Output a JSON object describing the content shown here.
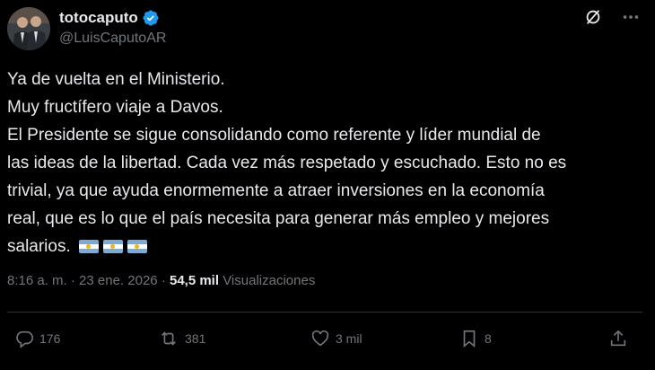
{
  "author": {
    "display_name": "totocaputo",
    "handle": "@LuisCaputoAR",
    "verified": true,
    "verified_color": "#1d9bf0"
  },
  "post": {
    "lines": [
      "Ya de vuelta en el Ministerio.",
      "Muy fructífero viaje a Davos.",
      "El Presidente se sigue consolidando como referente y líder mundial de",
      "las ideas de la libertad. Cada vez más respetado y escuchado. Esto no es",
      "trivial, ya que ayuda enormemente a atraer inversiones en la economía",
      "real, que es lo que el país necesita para generar más empleo y mejores",
      "salarios."
    ],
    "emoji": [
      "flag-argentina",
      "flag-argentina",
      "flag-argentina"
    ]
  },
  "meta": {
    "time": "8:16 a. m.",
    "separator": "·",
    "date": "23 ene. 2026",
    "views_count": "54,5 mil",
    "views_label": "Visualizaciones"
  },
  "actions": {
    "replies": "176",
    "reposts": "381",
    "likes": "3 mil",
    "bookmarks": "8"
  },
  "icons": [
    "grok-icon",
    "more-options-icon",
    "reply-icon",
    "repost-icon",
    "like-icon",
    "bookmark-icon",
    "share-icon"
  ],
  "colors": {
    "background": "#000000",
    "text": "#e7e9ea",
    "secondary_text": "#71767b",
    "divider": "#2f3336"
  }
}
